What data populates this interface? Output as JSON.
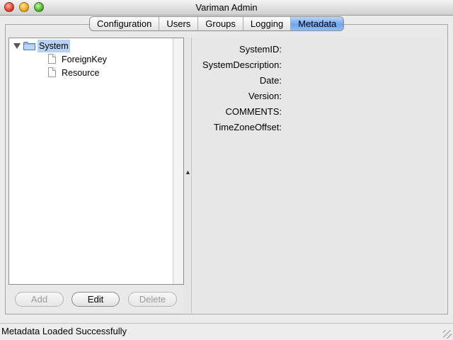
{
  "window": {
    "title": "Variman Admin"
  },
  "tabs": [
    {
      "label": "Configuration"
    },
    {
      "label": "Users"
    },
    {
      "label": "Groups"
    },
    {
      "label": "Logging"
    },
    {
      "label": "Metadata",
      "selected": true
    }
  ],
  "tree": {
    "root": {
      "label": "System",
      "expanded": true,
      "icon": "folder-icon"
    },
    "children": [
      {
        "label": "ForeignKey",
        "icon": "file-icon"
      },
      {
        "label": "Resource",
        "icon": "file-icon"
      }
    ]
  },
  "details": {
    "fields": [
      {
        "label": "SystemID:",
        "value": ""
      },
      {
        "label": "SystemDescription:",
        "value": ""
      },
      {
        "label": "Date:",
        "value": ""
      },
      {
        "label": "Version:",
        "value": ""
      },
      {
        "label": "COMMENTS:",
        "value": ""
      },
      {
        "label": "TimeZoneOffset:",
        "value": ""
      }
    ]
  },
  "buttons": {
    "add": "Add",
    "edit": "Edit",
    "delete": "Delete"
  },
  "status": {
    "text": "Metadata Loaded Successfully"
  },
  "colors": {
    "selected_tab": "#6ea6ef",
    "tree_selection": "#b7d1f2"
  }
}
